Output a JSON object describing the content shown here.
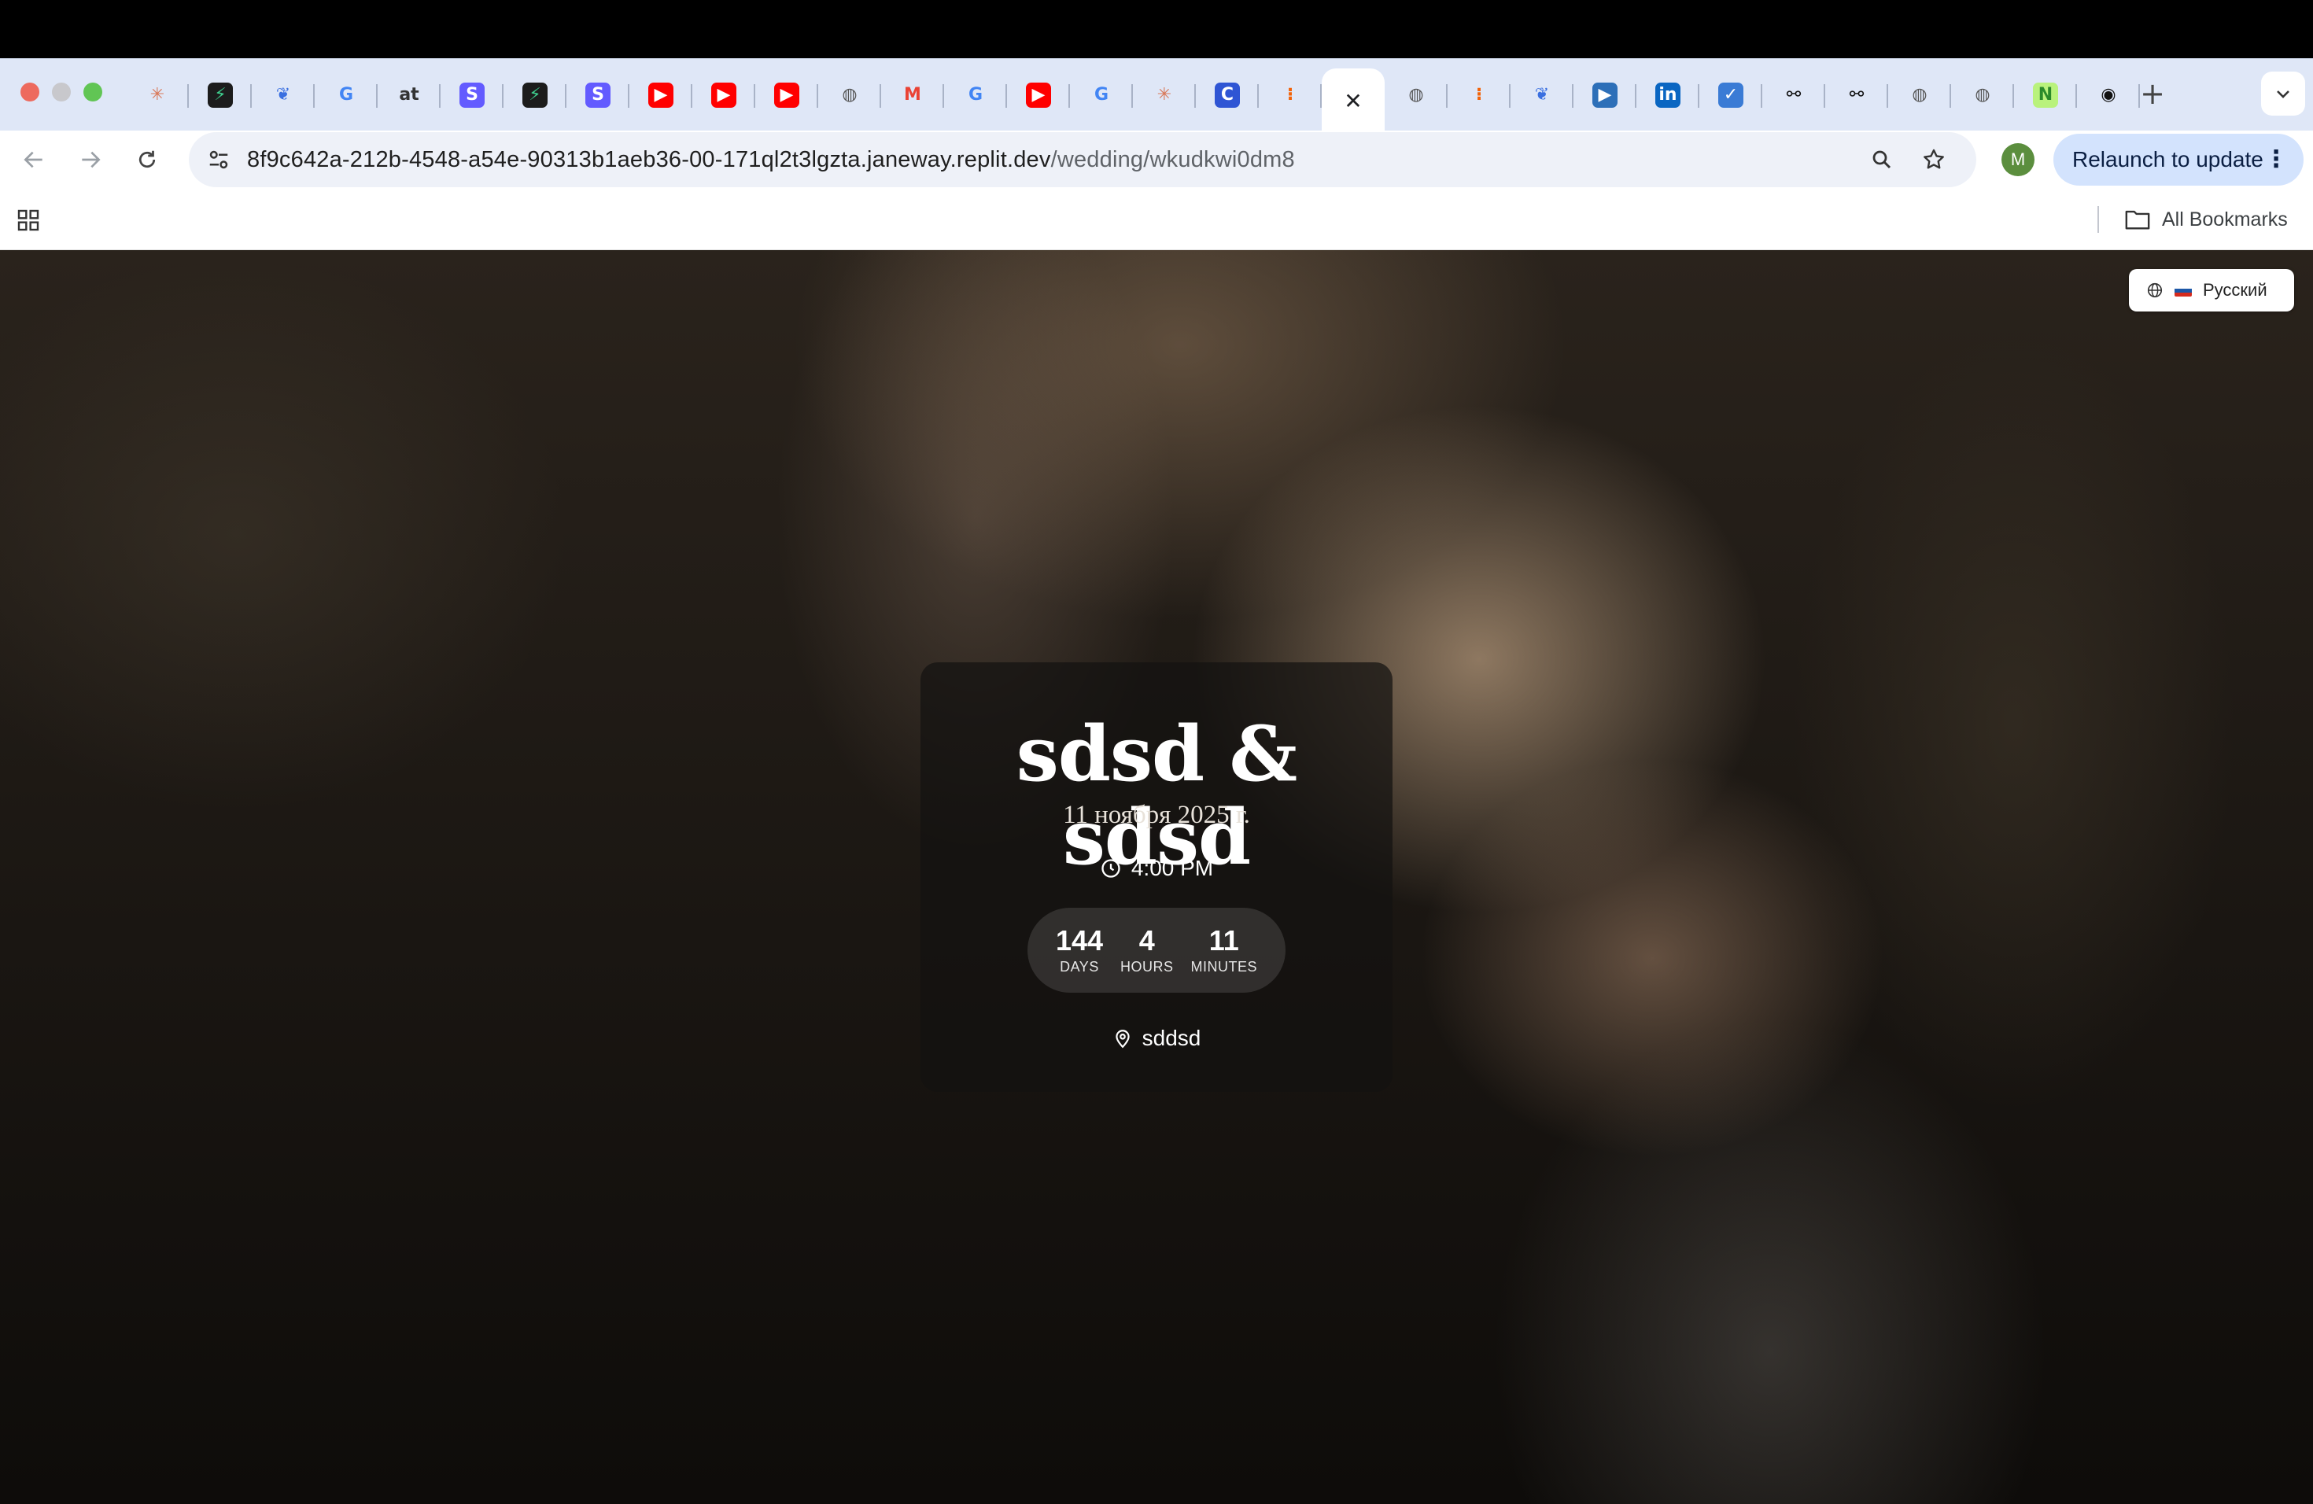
{
  "browser": {
    "tabs": [
      {
        "icon": "claude-icon",
        "glyph": "✳",
        "bg": "transparent",
        "fg": "#d97757"
      },
      {
        "icon": "supabase-icon",
        "glyph": "⚡",
        "bg": "#1c1c1c",
        "fg": "#3ecf8e"
      },
      {
        "icon": "bird-icon",
        "glyph": "❦",
        "bg": "transparent",
        "fg": "#3a6fe0"
      },
      {
        "icon": "google-icon",
        "glyph": "G",
        "bg": "transparent",
        "fg": "#4285f4"
      },
      {
        "icon": "at-icon",
        "glyph": "at",
        "bg": "transparent",
        "fg": "#333333"
      },
      {
        "icon": "stripe-icon",
        "glyph": "S",
        "bg": "#635bff",
        "fg": "#ffffff"
      },
      {
        "icon": "supabase-icon",
        "glyph": "⚡",
        "bg": "#1c1c1c",
        "fg": "#3ecf8e"
      },
      {
        "icon": "stripe-icon",
        "glyph": "S",
        "bg": "#635bff",
        "fg": "#ffffff"
      },
      {
        "icon": "youtube-icon",
        "glyph": "▶",
        "bg": "#ff0000",
        "fg": "#ffffff"
      },
      {
        "icon": "youtube-icon",
        "glyph": "▶",
        "bg": "#ff0000",
        "fg": "#ffffff"
      },
      {
        "icon": "youtube-icon",
        "glyph": "▶",
        "bg": "#ff0000",
        "fg": "#ffffff"
      },
      {
        "icon": "globe-icon",
        "glyph": "◍",
        "bg": "transparent",
        "fg": "#555555"
      },
      {
        "icon": "gmail-icon",
        "glyph": "M",
        "bg": "transparent",
        "fg": "#ea4335"
      },
      {
        "icon": "google-icon",
        "glyph": "G",
        "bg": "transparent",
        "fg": "#4285f4"
      },
      {
        "icon": "youtube-icon",
        "glyph": "▶",
        "bg": "#ff0000",
        "fg": "#ffffff"
      },
      {
        "icon": "google-icon",
        "glyph": "G",
        "bg": "transparent",
        "fg": "#4285f4"
      },
      {
        "icon": "claude-icon",
        "glyph": "✳",
        "bg": "transparent",
        "fg": "#d97757"
      },
      {
        "icon": "c-icon",
        "glyph": "C",
        "bg": "#2f55d4",
        "fg": "#ffffff"
      },
      {
        "icon": "replit-icon",
        "glyph": "⁝",
        "bg": "transparent",
        "fg": "#f26207"
      },
      {
        "icon": "close-icon",
        "glyph": "✕",
        "bg": "transparent",
        "fg": "#202124",
        "active": true
      },
      {
        "icon": "globe-icon",
        "glyph": "◍",
        "bg": "transparent",
        "fg": "#555555"
      },
      {
        "icon": "replit-icon",
        "glyph": "⁝",
        "bg": "transparent",
        "fg": "#f26207"
      },
      {
        "icon": "bird-icon",
        "glyph": "❦",
        "bg": "transparent",
        "fg": "#3a6fe0"
      },
      {
        "icon": "video-icon",
        "glyph": "▶",
        "bg": "#2d6fb8",
        "fg": "#ffffff"
      },
      {
        "icon": "linkedin-icon",
        "glyph": "in",
        "bg": "#0a66c2",
        "fg": "#ffffff"
      },
      {
        "icon": "check-icon",
        "glyph": "✓",
        "bg": "#3a7bd5",
        "fg": "#ffffff"
      },
      {
        "icon": "link-icon",
        "glyph": "⚯",
        "bg": "transparent",
        "fg": "#111111"
      },
      {
        "icon": "link-icon",
        "glyph": "⚯",
        "bg": "transparent",
        "fg": "#111111"
      },
      {
        "icon": "globe-icon",
        "glyph": "◍",
        "bg": "transparent",
        "fg": "#555555"
      },
      {
        "icon": "globe-icon",
        "glyph": "◍",
        "bg": "transparent",
        "fg": "#555555"
      },
      {
        "icon": "notion-icon",
        "glyph": "N",
        "bg": "#b9f27c",
        "fg": "#2a8a2a"
      },
      {
        "icon": "github-icon",
        "glyph": "◉",
        "bg": "transparent",
        "fg": "#111111"
      }
    ],
    "new_tab_label": "+",
    "url_host": "8f9c642a-212b-4548-a54e-90313b1aeb36-00-171ql2t3lgzta.janeway.replit.dev",
    "url_path": "/wedding/wkudkwi0dm8",
    "profile_initial": "M",
    "relaunch_label": "Relaunch to update",
    "all_bookmarks_label": "All Bookmarks"
  },
  "page": {
    "language_label": "Русский",
    "couple_names": "sdsd & sdsd",
    "date": "11 ноября 2025 г.",
    "time": "4:00 PM",
    "countdown": [
      {
        "value": "144",
        "label": "DAYS"
      },
      {
        "value": "4",
        "label": "HOURS"
      },
      {
        "value": "11",
        "label": "MINUTES"
      }
    ],
    "venue": "sddsd"
  },
  "colors": {
    "tabstrip_bg": "#dfe7f7",
    "relaunch_bg": "#d3e3fd",
    "card_bg": "rgba(20,18,16,0.72)"
  }
}
